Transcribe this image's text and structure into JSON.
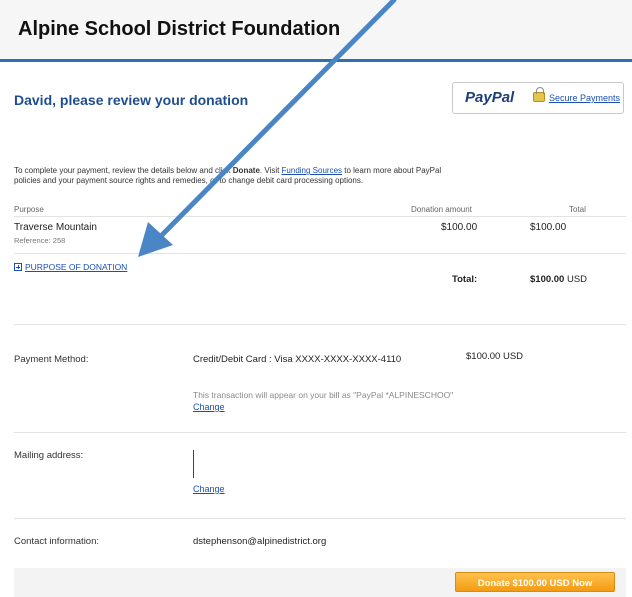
{
  "header": {
    "title": "Alpine School District Foundation"
  },
  "review": {
    "title": "David, please review your donation"
  },
  "paypal": {
    "logo_text": "PayPal",
    "secure_link": "Secure Payments"
  },
  "intro": {
    "part1": "To complete your payment, review the details below and click ",
    "donate_word": "Donate",
    "part2": ". Visit ",
    "funding_link": "Funding Sources",
    "part3": " to learn more about PayPal policies and your payment source rights and remedies, or to change debit card processing options."
  },
  "table": {
    "headers": {
      "purpose": "Purpose",
      "donation_amount": "Donation amount",
      "total": "Total"
    },
    "item": {
      "name": "Traverse Mountain",
      "reference": "Reference: 258",
      "donation_amount": "$100.00",
      "total": "$100.00"
    },
    "purpose_link": "PURPOSE OF DONATION",
    "total_label": "Total:",
    "total_amount": "$100.00",
    "total_currency": "USD"
  },
  "payment": {
    "label": "Payment Method:",
    "card": "Credit/Debit Card : Visa XXXX-XXXX-XXXX-4110",
    "amount": "$100.00 USD",
    "note": "This transaction will appear on your bill as \"PayPal *ALPINESCHOO\"",
    "change_link": "Change"
  },
  "mailing": {
    "label": "Mailing address:",
    "change_link": "Change"
  },
  "contact": {
    "label": "Contact information:",
    "email": "dstephenson@alpinedistrict.org"
  },
  "donate_button": {
    "label": "Donate $100.00 USD Now"
  },
  "colors": {
    "accent": "#2f6fb0",
    "link": "#1a4fb5",
    "button": "#f39b12",
    "annotation_arrow": "#4a86c5"
  }
}
